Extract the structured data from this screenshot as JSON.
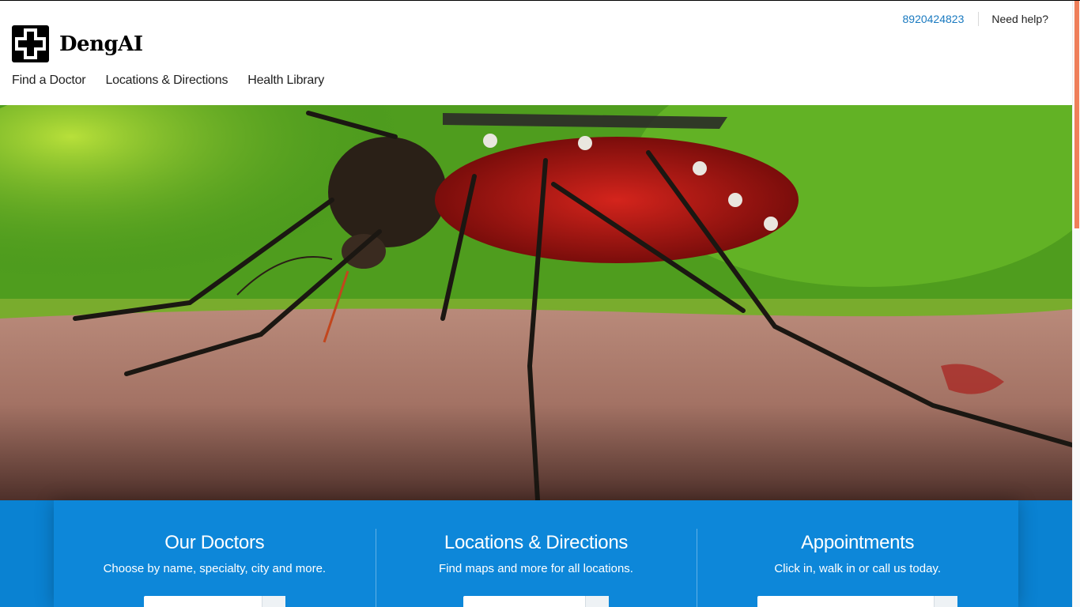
{
  "brand": {
    "name": "DengAI",
    "logo_icon": "cross-logo-icon"
  },
  "utility": {
    "phone": "8920424823",
    "help": "Need help?"
  },
  "nav": [
    {
      "label": "Find a Doctor"
    },
    {
      "label": "Locations & Directions"
    },
    {
      "label": "Health Library"
    }
  ],
  "hero": {
    "image": "mosquito-on-skin-photo"
  },
  "cards": [
    {
      "title": "Our Doctors",
      "text": "Choose by name, specialty, city and more."
    },
    {
      "title": "Locations & Directions",
      "text": "Find maps and more for all locations."
    },
    {
      "title": "Appointments",
      "text": "Click in, walk in or call us today."
    }
  ],
  "colors": {
    "accent": "#0a82d2",
    "link": "#1a7ac0",
    "scroll_thumb": "#ef7f5a"
  }
}
